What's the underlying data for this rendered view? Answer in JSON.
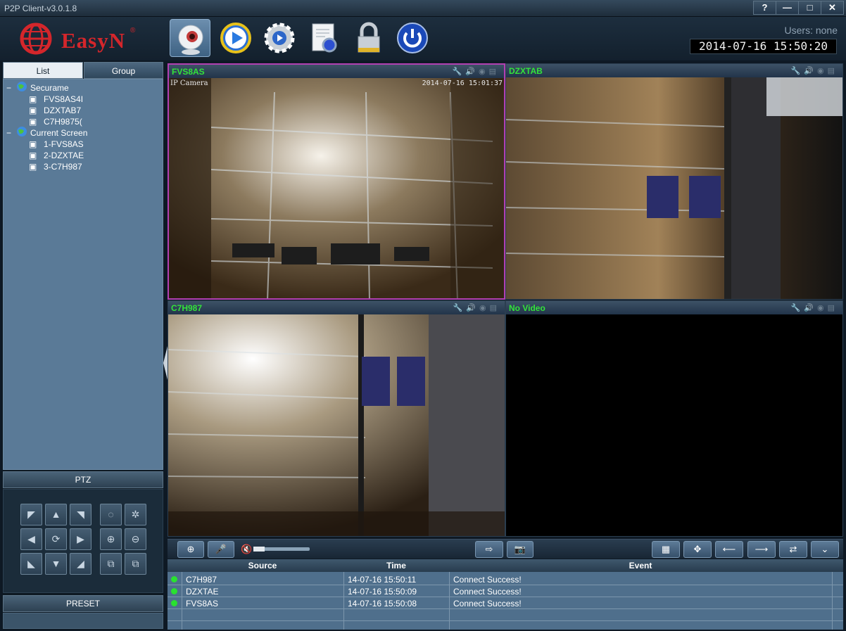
{
  "window": {
    "title": "P2P Client-v3.0.1.8",
    "help_label": "?",
    "min_label": "—",
    "max_label": "□",
    "close_label": "✕"
  },
  "header": {
    "logo_text": "EasyN",
    "logo_reg": "®",
    "users_text": "Users: none",
    "clock": "2014-07-16 15:50:20",
    "toolbar": [
      {
        "icon": "camera-icon"
      },
      {
        "icon": "playback-icon"
      },
      {
        "icon": "settings-gear-icon"
      },
      {
        "icon": "log-document-icon"
      },
      {
        "icon": "lock-icon"
      },
      {
        "icon": "power-icon"
      }
    ]
  },
  "sidebar": {
    "tabs": {
      "list": "List",
      "group": "Group"
    },
    "tree": {
      "root1": "Securame",
      "root1_items": [
        "FVS8AS4I",
        "DZXTAB7",
        "C7H9875("
      ],
      "root2": "Current Screen",
      "root2_items": [
        "1-FVS8AS",
        "2-DZXTAE",
        "3-C7H987"
      ]
    },
    "ptz_label": "PTZ",
    "preset_label": "PRESET",
    "ptz_buttons": [
      "◤",
      "▲",
      "◥",
      "◌",
      "✲",
      "◀",
      "⟳",
      "▶",
      "⊕",
      "⊖",
      "◣",
      "▼",
      "◢",
      "⧉",
      "⧉"
    ]
  },
  "cameras": [
    {
      "name": "FVS8AS",
      "overlay_label": "IP Camera",
      "overlay_time": "2014-07-16 15:01:37"
    },
    {
      "name": "DZXTAB"
    },
    {
      "name": "C7H987"
    },
    {
      "name": "No Video"
    }
  ],
  "controls": {
    "zoom_icon": "zoom-in-icon",
    "mic_icon": "microphone-icon",
    "volume_icon": "speaker-muted-icon",
    "record_icon": "record-icon",
    "snapshot_icon": "snapshot-icon",
    "layout_icon": "grid-layout-icon",
    "fullscreen_icon": "fullscreen-icon",
    "prev_icon": "arrow-left-icon",
    "next_icon": "arrow-right-icon",
    "cycle_icon": "cycle-icon",
    "collapse_icon": "double-chevron-down-icon",
    "volume_level": 0.2
  },
  "log": {
    "headers": {
      "source": "Source",
      "time": "Time",
      "event": "Event"
    },
    "rows": [
      {
        "source": "C7H987",
        "time": "14-07-16 15:50:11",
        "event": "Connect Success!"
      },
      {
        "source": "DZXTAE",
        "time": "14-07-16 15:50:09",
        "event": "Connect Success!"
      },
      {
        "source": "FVS8AS",
        "time": "14-07-16 15:50:08",
        "event": "Connect Success!"
      }
    ]
  },
  "colors": {
    "accent": "#33e33a",
    "active_border": "#b23fb2",
    "brand": "#d4262b"
  }
}
